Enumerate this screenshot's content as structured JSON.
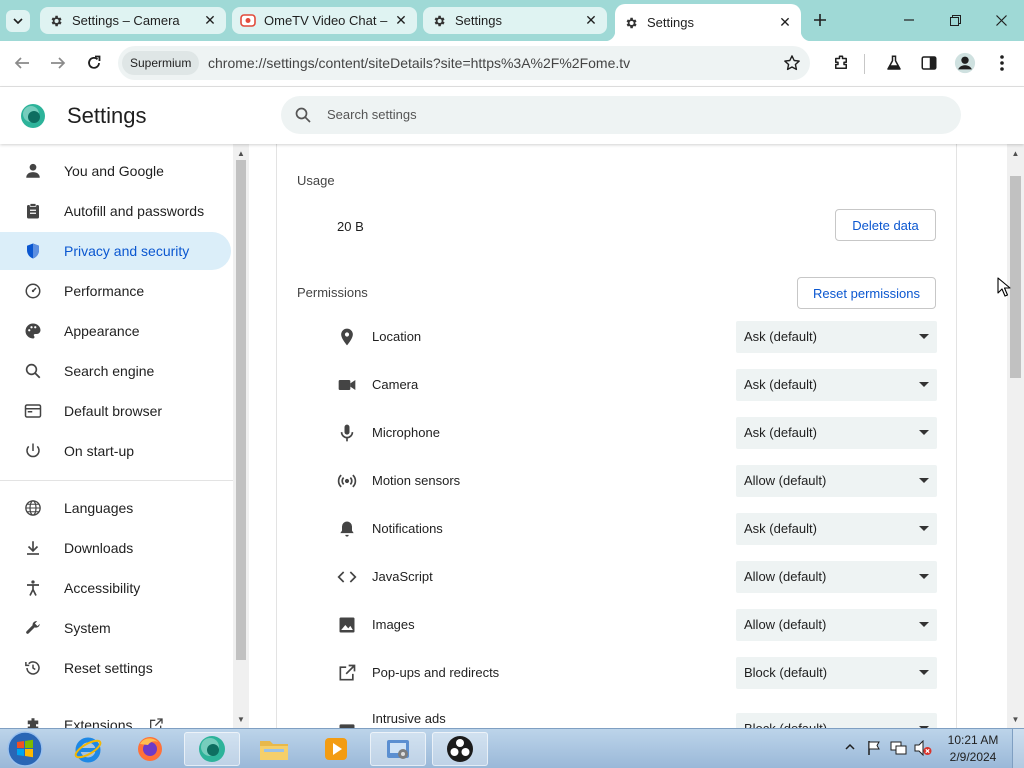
{
  "tabs": [
    {
      "title": "Settings – Camera",
      "icon": "gear-icon"
    },
    {
      "title": "OmeTV Video Chat –",
      "icon": "ometv-icon"
    },
    {
      "title": "Settings",
      "icon": "gear-icon"
    },
    {
      "title": "Settings",
      "icon": "gear-icon",
      "active": true
    }
  ],
  "toolbar": {
    "chip_label": "Supermium",
    "url": "chrome://settings/content/siteDetails?site=https%3A%2F%2Fome.tv"
  },
  "settings": {
    "title": "Settings",
    "search_placeholder": "Search settings"
  },
  "sidebar": {
    "items": [
      {
        "label": "You and Google",
        "icon": "person-icon"
      },
      {
        "label": "Autofill and passwords",
        "icon": "clipboard-icon"
      },
      {
        "label": "Privacy and security",
        "icon": "shield-icon",
        "active": true
      },
      {
        "label": "Performance",
        "icon": "gauge-icon"
      },
      {
        "label": "Appearance",
        "icon": "palette-icon"
      },
      {
        "label": "Search engine",
        "icon": "search-icon"
      },
      {
        "label": "Default browser",
        "icon": "browser-icon"
      },
      {
        "label": "On start-up",
        "icon": "power-icon"
      },
      {
        "label": "Languages",
        "icon": "globe-icon"
      },
      {
        "label": "Downloads",
        "icon": "download-icon"
      },
      {
        "label": "Accessibility",
        "icon": "accessibility-icon"
      },
      {
        "label": "System",
        "icon": "wrench-icon"
      },
      {
        "label": "Reset settings",
        "icon": "history-icon"
      },
      {
        "label": "Extensions",
        "icon": "puzzle-icon"
      }
    ]
  },
  "main": {
    "usage_label": "Usage",
    "usage_value": "20 B",
    "delete_button": "Delete data",
    "permissions_label": "Permissions",
    "reset_button": "Reset permissions",
    "permissions": [
      {
        "label": "Location",
        "value": "Ask (default)",
        "icon": "location-pin-icon"
      },
      {
        "label": "Camera",
        "value": "Ask (default)",
        "icon": "camera-icon"
      },
      {
        "label": "Microphone",
        "value": "Ask (default)",
        "icon": "microphone-icon"
      },
      {
        "label": "Motion sensors",
        "value": "Allow (default)",
        "icon": "sensors-icon"
      },
      {
        "label": "Notifications",
        "value": "Ask (default)",
        "icon": "bell-icon"
      },
      {
        "label": "JavaScript",
        "value": "Allow (default)",
        "icon": "code-icon"
      },
      {
        "label": "Images",
        "value": "Allow (default)",
        "icon": "image-icon"
      },
      {
        "label": "Pop-ups and redirects",
        "value": "Block (default)",
        "icon": "open-in-new-icon"
      },
      {
        "label": "Intrusive ads",
        "value": "Block (default)",
        "icon": "ads-icon"
      }
    ]
  },
  "taskbar": {
    "time": "10:21 AM",
    "date": "2/9/2024"
  },
  "colors": {
    "tabstrip": "#9fd9d6",
    "accent": "#0b57d0",
    "active_nav_bg": "#dbeef9"
  }
}
